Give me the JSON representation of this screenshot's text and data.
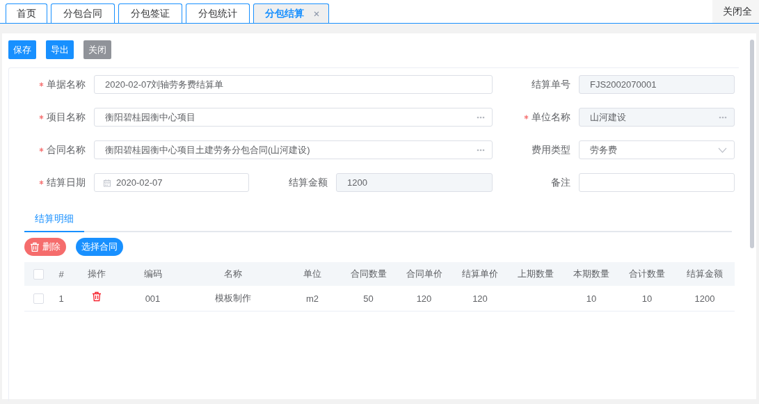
{
  "tabs": [
    {
      "label": "首页",
      "selected": false,
      "closable": false
    },
    {
      "label": "分包合同",
      "selected": false,
      "closable": false
    },
    {
      "label": "分包签证",
      "selected": false,
      "closable": false
    },
    {
      "label": "分包统计",
      "selected": false,
      "closable": false
    },
    {
      "label": "分包结算",
      "selected": true,
      "closable": true
    }
  ],
  "close_all": "关闭全",
  "toolbar": [
    {
      "label": "保存",
      "kind": "primary"
    },
    {
      "label": "导出",
      "kind": "primary"
    },
    {
      "label": "关闭",
      "kind": "neutral"
    }
  ],
  "form": {
    "rows": [
      [
        {
          "label": "单据名称",
          "required": true,
          "kind": "text",
          "readonly": false,
          "value": "2020-02-07刘轴劳务费结算单"
        },
        {
          "label": "结算单号",
          "required": false,
          "kind": "text",
          "readonly": true,
          "value": "FJS2002070001"
        }
      ],
      [
        {
          "label": "项目名称",
          "required": true,
          "kind": "lookup",
          "readonly": false,
          "value": "衡阳碧桂园衡中心项目"
        },
        {
          "label": "单位名称",
          "required": true,
          "kind": "lookup",
          "readonly": true,
          "value": "山河建设"
        }
      ],
      [
        {
          "label": "合同名称",
          "required": true,
          "kind": "lookup",
          "readonly": false,
          "value": "衡阳碧桂园衡中心项目土建劳务分包合同(山河建设)"
        },
        {
          "label": "费用类型",
          "required": false,
          "kind": "select",
          "readonly": false,
          "value": "劳务费"
        }
      ],
      [
        {
          "label": "结算日期",
          "required": true,
          "kind": "date",
          "readonly": false,
          "value": "2020-02-07"
        },
        {
          "label": "结算金额",
          "required": false,
          "kind": "text",
          "readonly": true,
          "value": "1200"
        },
        {
          "label": "备注",
          "required": false,
          "kind": "text",
          "readonly": false
        }
      ]
    ]
  },
  "detail_tabs": [
    {
      "label": "结算明细",
      "selected": true
    }
  ],
  "detail_actions": [
    {
      "label": "删除",
      "kind": "danger"
    },
    {
      "label": "选择合同",
      "kind": "primary"
    }
  ],
  "table": {
    "all_checked": false,
    "columns": [
      "#",
      "操作",
      "编码",
      "名称",
      "单位",
      "合同数量",
      "合同单价",
      "结算单价",
      "上期数量",
      "本期数量",
      "合计数量",
      "结算金额"
    ],
    "rows": [
      {
        "selected": false,
        "cells": [
          "1",
          "",
          "001",
          "模板制作",
          "m2",
          "50",
          "120",
          "120",
          "",
          "10",
          "10",
          "1200"
        ]
      }
    ]
  }
}
